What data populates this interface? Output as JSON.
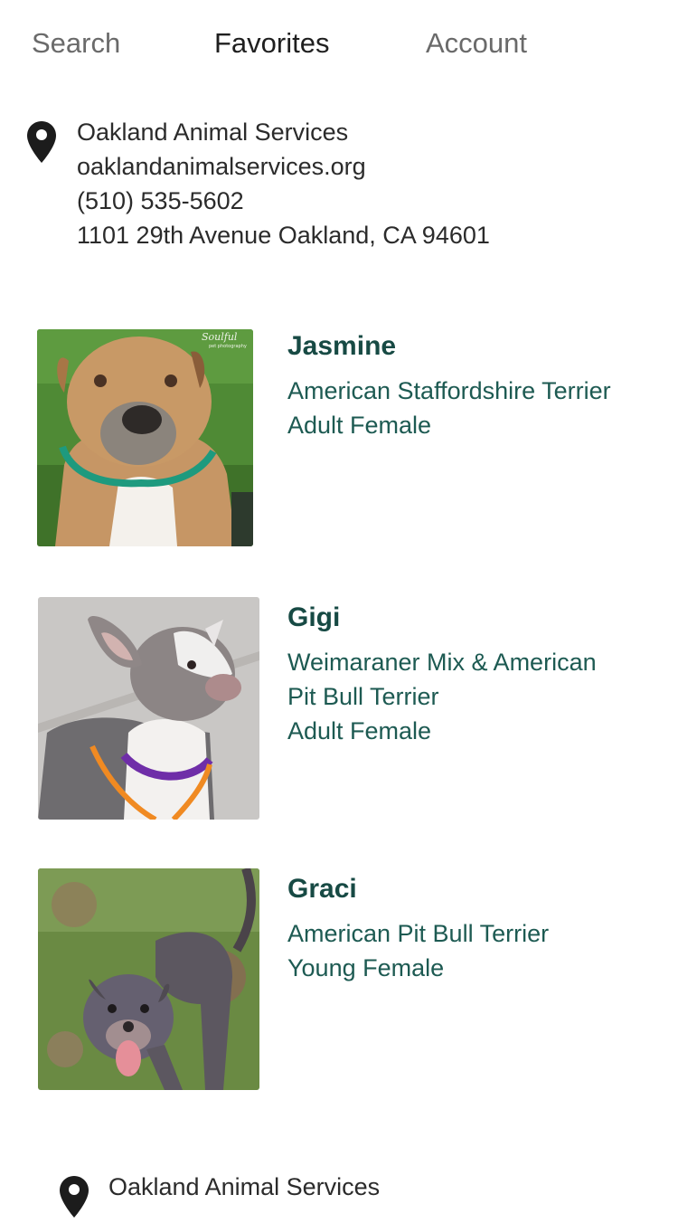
{
  "tabs": {
    "search": "Search",
    "favorites": "Favorites",
    "account": "Account"
  },
  "shelter_top": {
    "name": "Oakland Animal Services",
    "website": "oaklandanimalservices.org",
    "phone": "(510) 535-5602",
    "address": "1101 29th Avenue Oakland, CA 94601"
  },
  "pets": [
    {
      "name": "Jasmine",
      "lines": [
        "American Staffordshire Terrier",
        "Adult Female"
      ],
      "photo_watermark": "Soulful",
      "photo_watermark_sub": "pet photography"
    },
    {
      "name": "Gigi",
      "lines": [
        "Weimaraner Mix & American",
        "Pit Bull Terrier",
        "Adult Female"
      ]
    },
    {
      "name": "Graci",
      "lines": [
        "American Pit Bull Terrier",
        "Young Female"
      ]
    }
  ],
  "shelter_bottom": {
    "name": "Oakland Animal Services"
  },
  "colors": {
    "pet_text": "#1d5a52",
    "pet_name": "#174a44",
    "active_tab": "#1f1f1f",
    "inactive_tab": "#6a6a6a"
  }
}
